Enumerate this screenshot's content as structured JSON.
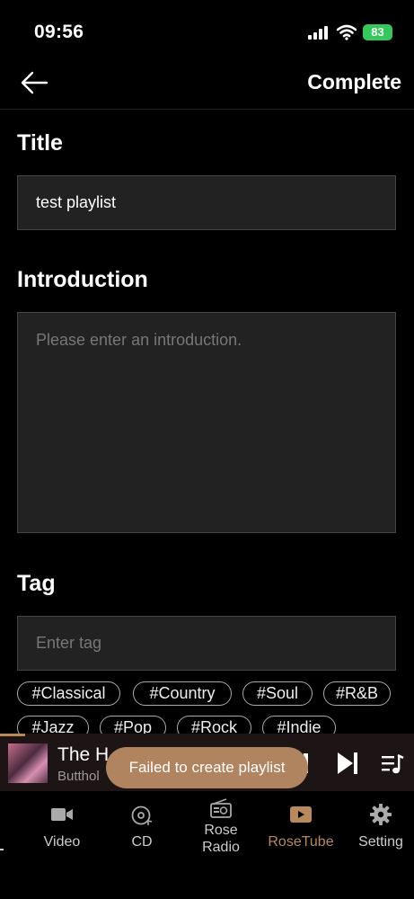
{
  "status_bar": {
    "time": "09:56",
    "battery": "83"
  },
  "header": {
    "complete_label": "Complete"
  },
  "form": {
    "title_label": "Title",
    "title_value": "test playlist",
    "intro_label": "Introduction",
    "intro_placeholder": "Please enter an introduction.",
    "tag_label": "Tag",
    "tag_placeholder": "Enter tag",
    "tags": [
      "#Classical",
      "#Country",
      "#Soul",
      "#R&B",
      "#Jazz",
      "#Pop",
      "#Rock",
      "#Indie"
    ]
  },
  "now_playing": {
    "title": "The H",
    "artist": "Butthol",
    "progress": 0.06
  },
  "toast": "Failed to create playlist",
  "nav": {
    "items": [
      {
        "label": "Video",
        "icon": "video-icon"
      },
      {
        "label": "CD",
        "icon": "cd-icon"
      },
      {
        "label": "Rose Radio",
        "icon": "radio-icon"
      },
      {
        "label": "RoseTube",
        "icon": "youtube-icon",
        "active": true
      },
      {
        "label": "Setting",
        "icon": "gear-icon"
      }
    ]
  },
  "colors": {
    "accent": "#b8895a",
    "field_bg": "#222222",
    "battery": "#34c759"
  }
}
